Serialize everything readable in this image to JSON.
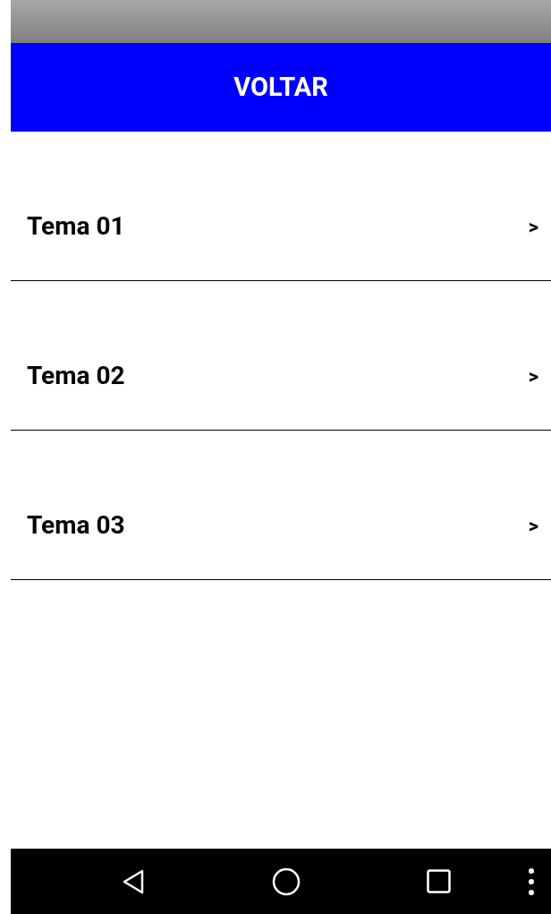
{
  "header": {
    "title": "VOLTAR"
  },
  "topics": [
    {
      "label": "Tema 01",
      "chevron": ">"
    },
    {
      "label": "Tema 02",
      "chevron": ">"
    },
    {
      "label": "Tema 03",
      "chevron": ">"
    }
  ]
}
